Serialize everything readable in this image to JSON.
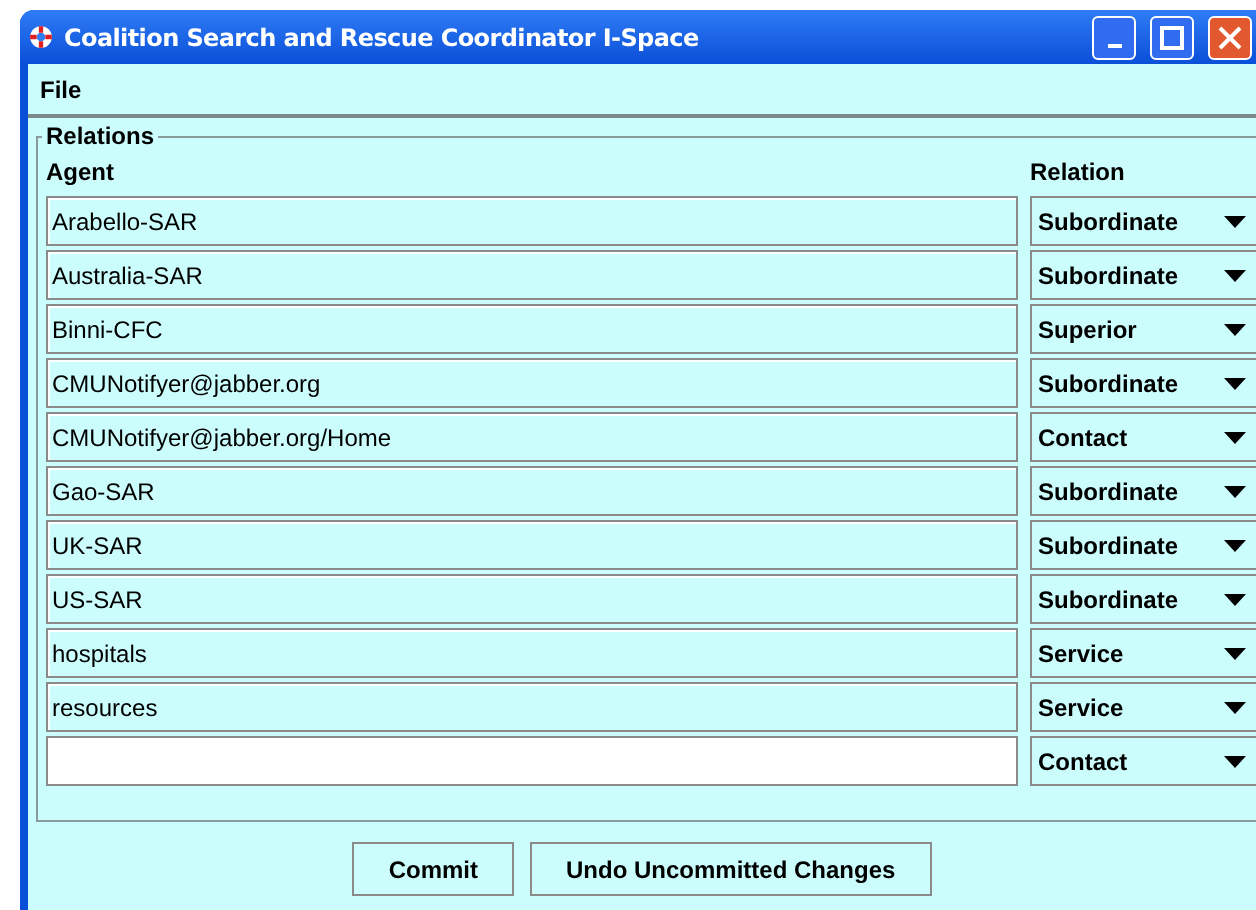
{
  "window": {
    "title": "Coalition Search and Rescue Coordinator I-Space"
  },
  "menu": [
    "File"
  ],
  "relations": {
    "title": "Relations",
    "columns": [
      "Agent",
      "Relation"
    ],
    "rows": [
      {
        "agent": "Arabello-SAR",
        "relation": "Subordinate",
        "editable": false
      },
      {
        "agent": "Australia-SAR",
        "relation": "Subordinate",
        "editable": false
      },
      {
        "agent": "Binni-CFC",
        "relation": "Superior",
        "editable": false
      },
      {
        "agent": "CMUNotifyer@jabber.org",
        "relation": "Subordinate",
        "editable": false
      },
      {
        "agent": "CMUNotifyer@jabber.org/Home",
        "relation": "Contact",
        "editable": false
      },
      {
        "agent": "Gao-SAR",
        "relation": "Subordinate",
        "editable": false
      },
      {
        "agent": "UK-SAR",
        "relation": "Subordinate",
        "editable": false
      },
      {
        "agent": "US-SAR",
        "relation": "Subordinate",
        "editable": false
      },
      {
        "agent": "hospitals",
        "relation": "Service",
        "editable": false
      },
      {
        "agent": "resources",
        "relation": "Service",
        "editable": false
      },
      {
        "agent": "",
        "relation": "Contact",
        "editable": true
      }
    ]
  },
  "buttons": [
    "Commit",
    "Undo Uncommitted Changes"
  ]
}
